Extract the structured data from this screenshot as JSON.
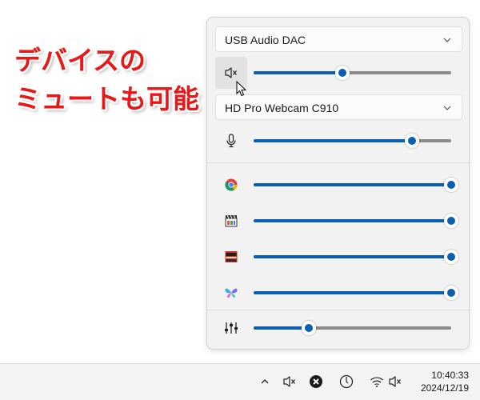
{
  "annotation": {
    "line1": "デバイスの",
    "line2": "ミュートも可能"
  },
  "output_device": {
    "name": "USB Audio DAC",
    "muted": true,
    "volume_level": 0.45,
    "icon": "speaker-muted-icon"
  },
  "input_device": {
    "name": "HD Pro Webcam C910",
    "volume_level": 0.8,
    "icon": "microphone-icon"
  },
  "apps": [
    {
      "name": "chrome",
      "icon": "chrome-icon",
      "volume_level": 1.0
    },
    {
      "name": "media-app",
      "icon": "clapperboard-icon",
      "volume_level": 1.0
    },
    {
      "name": "video-app",
      "icon": "video-thumbnail-icon",
      "volume_level": 1.0
    },
    {
      "name": "butterfly-app",
      "icon": "butterfly-icon",
      "volume_level": 1.0
    }
  ],
  "mixer": {
    "icon": "equalizer-icon",
    "volume_level": 0.28
  },
  "colors": {
    "accent": "#0a5fb4",
    "annotation": "#e81818"
  },
  "taskbar": {
    "time": "10:40:33",
    "date": "2024/12/19",
    "icons": [
      "chevron-up-icon",
      "speaker-muted-icon",
      "close-circle-icon",
      "timer-icon",
      "wifi-icon",
      "speaker-muted-icon"
    ]
  }
}
